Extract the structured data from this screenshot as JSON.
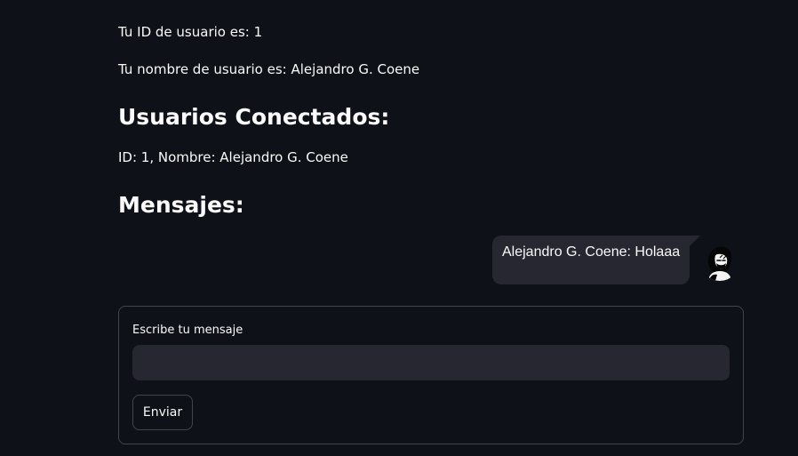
{
  "user_info": {
    "id_text": "Tu ID de usuario es: 1",
    "name_text": "Tu nombre de usuario es: Alejandro G. Coene"
  },
  "connected_users": {
    "heading": "Usuarios Conectados:",
    "items": [
      {
        "text": "ID: 1, Nombre: Alejandro G. Coene"
      }
    ]
  },
  "messages": {
    "heading": "Mensajes:",
    "items": [
      {
        "text": "Alejandro G. Coene: Holaaa",
        "avatar_icon": "user-avatar-icon"
      }
    ]
  },
  "message_form": {
    "label": "Escribe tu mensaje",
    "input_value": "",
    "submit_label": "Enviar"
  },
  "colors": {
    "background": "#0e1117",
    "surface": "#262730",
    "text": "#fafafa"
  }
}
